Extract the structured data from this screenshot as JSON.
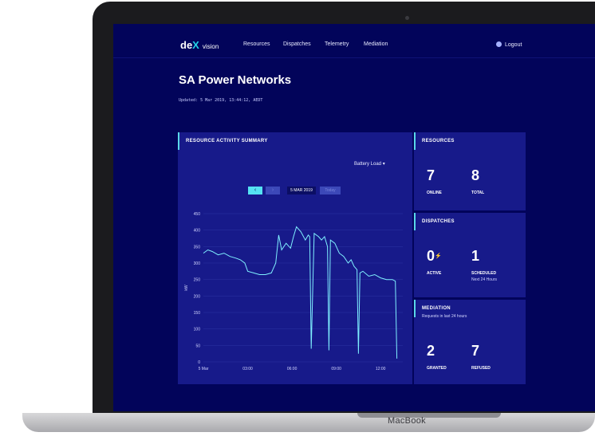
{
  "device": {
    "brand": "MacBook"
  },
  "nav": {
    "logo_main": "de",
    "logo_x": "X",
    "logo_sub": "vision",
    "items": [
      "Resources",
      "Dispatches",
      "Telemetry",
      "Mediation"
    ],
    "logout": "Logout"
  },
  "page": {
    "title": "SA Power Networks",
    "updated": "Updated: 5 Mar 2019, 13:44:12, AEDT"
  },
  "activity": {
    "title": "RESOURCE ACTIVITY SUMMARY",
    "dropdown": "Battery Load",
    "prev": "‹",
    "next": "›",
    "date": "5 MAR 2019",
    "today": "Today"
  },
  "resources": {
    "title": "RESOURCES",
    "online": "7",
    "online_label": "ONLINE",
    "total": "8",
    "total_label": "TOTAL"
  },
  "dispatches": {
    "title": "DISPATCHES",
    "active": "0",
    "active_label": "ACTIVE",
    "scheduled": "1",
    "scheduled_label": "SCHEDULED",
    "scheduled_sub": "Next 24 Hours"
  },
  "mediation": {
    "title": "MEDIATION",
    "subtitle": "Requests in last 24 hours",
    "granted": "2",
    "granted_label": "GRANTED",
    "refused": "7",
    "refused_label": "REFUSED"
  },
  "colors": {
    "background": "#02045a",
    "panel": "#171a8a",
    "accent": "#5ad7e9",
    "line": "#7ff0ff"
  },
  "chart_data": {
    "type": "line",
    "ylabel": "kW",
    "ylim": [
      0,
      450
    ],
    "yticks": [
      0,
      50,
      100,
      150,
      200,
      250,
      300,
      350,
      400,
      450
    ],
    "xticks": [
      "5 Mar",
      "03:00",
      "06:00",
      "09:00",
      "12:00"
    ],
    "xlim": [
      0,
      13.5
    ],
    "grid": true,
    "series": [
      {
        "x": [
          0,
          0.3,
          0.6,
          1.0,
          1.4,
          1.8,
          2.2,
          2.5,
          2.8,
          3.0,
          3.4,
          3.8,
          4.2,
          4.6,
          4.9,
          5.1,
          5.3,
          5.6,
          5.9,
          6.1,
          6.3,
          6.6,
          6.9,
          7.1,
          7.2,
          7.3,
          7.5,
          7.8,
          8.0,
          8.2,
          8.4,
          8.5,
          8.6,
          8.9,
          9.2,
          9.5,
          9.8,
          10.0,
          10.2,
          10.4,
          10.5,
          10.6,
          10.8,
          11.2,
          11.6,
          12.0,
          12.4,
          12.8,
          13.0,
          13.1
        ],
        "values": [
          330,
          340,
          335,
          325,
          330,
          320,
          315,
          310,
          300,
          275,
          270,
          265,
          265,
          270,
          300,
          385,
          340,
          360,
          345,
          380,
          410,
          395,
          370,
          385,
          380,
          40,
          390,
          380,
          370,
          380,
          350,
          35,
          370,
          360,
          330,
          320,
          300,
          310,
          290,
          280,
          25,
          270,
          275,
          260,
          265,
          255,
          250,
          250,
          245,
          10
        ]
      }
    ]
  }
}
